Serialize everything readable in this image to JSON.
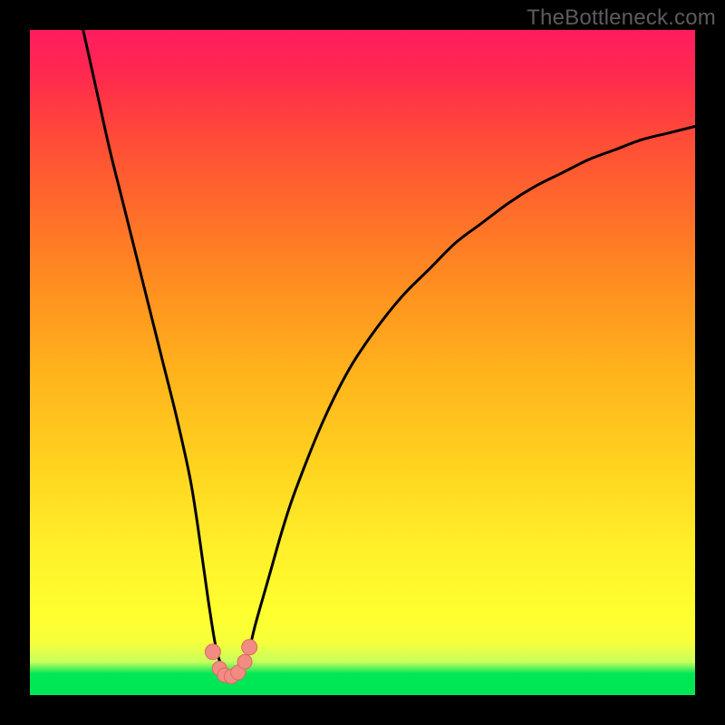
{
  "watermark": "TheBottleneck.com",
  "colors": {
    "frame": "#000000",
    "curve_stroke": "#000000",
    "marker_fill": "#f28b82",
    "marker_stroke": "#d96a63"
  },
  "chart_data": {
    "type": "line",
    "title": "",
    "xlabel": "",
    "ylabel": "",
    "xlim": [
      0,
      100
    ],
    "ylim": [
      0,
      100
    ],
    "grid": false,
    "legend": false,
    "series": [
      {
        "name": "bottleneck-curve",
        "x": [
          8,
          10,
          12,
          14,
          16,
          18,
          20,
          22,
          24,
          25,
          26,
          27,
          28,
          29,
          30,
          31,
          32,
          33,
          34,
          36,
          38,
          40,
          44,
          48,
          52,
          56,
          60,
          64,
          68,
          72,
          76,
          80,
          84,
          88,
          92,
          96,
          100
        ],
        "y": [
          100,
          91,
          82,
          74,
          66,
          58,
          50,
          42,
          33,
          27,
          20,
          13,
          7,
          4,
          3,
          3,
          4,
          7,
          11,
          18,
          25,
          31,
          41,
          49,
          55,
          60,
          64,
          68,
          71,
          74,
          76.5,
          78.5,
          80.5,
          82,
          83.5,
          84.5,
          85.5
        ]
      }
    ],
    "markers": {
      "name": "valley-dots",
      "x": [
        27.5,
        28.5,
        29.3,
        30.3,
        31.3,
        32.3,
        33.0
      ],
      "y": [
        6.5,
        4.0,
        3.0,
        2.8,
        3.4,
        5.0,
        7.2
      ]
    }
  }
}
